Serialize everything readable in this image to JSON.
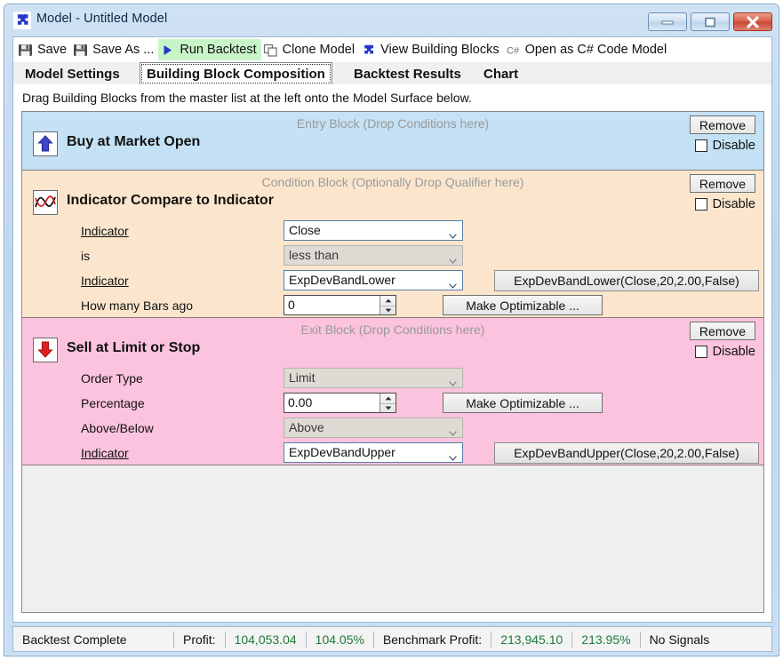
{
  "window": {
    "title": "Model - Untitled Model",
    "icon": "puzzle-piece-icon",
    "caption_buttons": {
      "minimize": "minimize-icon",
      "maximize": "maximize-icon",
      "close": "close-icon"
    }
  },
  "toolbar": {
    "items": [
      {
        "label": "Save",
        "icon": "floppy-disk-icon",
        "active": false
      },
      {
        "label": "Save As ...",
        "icon": "floppy-disk-icon",
        "active": false
      },
      {
        "label": "Run Backtest",
        "icon": "play-triangle-icon",
        "active": true
      },
      {
        "label": "Clone Model",
        "icon": "copy-windows-icon",
        "active": false
      },
      {
        "label": "View Building Blocks",
        "icon": "puzzle-piece-icon",
        "active": false
      },
      {
        "label": "Open as C# Code Model",
        "icon": "csharp-icon",
        "active": false
      }
    ]
  },
  "tabs": [
    {
      "label": "Model Settings",
      "selected": false
    },
    {
      "label": "Building Block Composition",
      "selected": true
    },
    {
      "label": "Backtest Results",
      "selected": false
    },
    {
      "label": "Chart",
      "selected": false
    }
  ],
  "hint": "Drag Building Blocks from the master list at the left onto the Model Surface below.",
  "blocks": [
    {
      "kind": "entry",
      "header": "Entry Block (Drop Conditions here)",
      "title": "Buy at Market Open",
      "icon": "blue-up-arrow-icon",
      "remove_label": "Remove",
      "disable_label": "Disable",
      "disable_checked": false,
      "fields": []
    },
    {
      "kind": "condition",
      "header": "Condition Block (Optionally Drop Qualifier here)",
      "title": "Indicator Compare to Indicator",
      "icon": "indicator-curve-icon",
      "remove_label": "Remove",
      "disable_label": "Disable",
      "disable_checked": false,
      "fields": [
        {
          "label": "Indicator",
          "link": true,
          "control": "combo",
          "value": "Close",
          "enabled": true,
          "side": null
        },
        {
          "label": "is",
          "link": false,
          "control": "combo",
          "value": "less than",
          "enabled": false,
          "side": null
        },
        {
          "label": "Indicator",
          "link": true,
          "control": "combo",
          "value": "ExpDevBandLower",
          "enabled": true,
          "side": "ExpDevBandLower(Close,20,2.00,False)",
          "side_type": "indicator-button"
        },
        {
          "label": "How many Bars ago",
          "link": false,
          "control": "spinner",
          "value": "0",
          "enabled": true,
          "side": "Make Optimizable ...",
          "side_type": "optimize-button"
        }
      ]
    },
    {
      "kind": "exit",
      "header": "Exit Block (Drop Conditions here)",
      "title": "Sell at Limit or Stop",
      "icon": "red-down-arrow-icon",
      "remove_label": "Remove",
      "disable_label": "Disable",
      "disable_checked": false,
      "fields": [
        {
          "label": "Order Type",
          "link": false,
          "control": "combo",
          "value": "Limit",
          "enabled": false,
          "side": null
        },
        {
          "label": "Percentage",
          "link": false,
          "control": "spinner",
          "value": "0.00",
          "enabled": true,
          "side": "Make Optimizable ...",
          "side_type": "optimize-button"
        },
        {
          "label": "Above/Below",
          "link": false,
          "control": "combo",
          "value": "Above",
          "enabled": false,
          "side": null
        },
        {
          "label": "Indicator",
          "link": true,
          "control": "combo",
          "value": "ExpDevBandUpper",
          "enabled": true,
          "side": "ExpDevBandUpper(Close,20,2.00,False)",
          "side_type": "indicator-button"
        }
      ]
    }
  ],
  "statusbar": {
    "status": "Backtest Complete",
    "profit_label": "Profit:",
    "profit_value": "104,053.04",
    "profit_percent": "104.05%",
    "benchmark_label": "Benchmark Profit:",
    "benchmark_value": "213,945.10",
    "benchmark_percent": "213.95%",
    "signals": "No Signals"
  },
  "colors": {
    "entry_block": "#c4e1f5",
    "condition_block": "#fbe6cd",
    "exit_block": "#fbc3dd",
    "run_highlight": "#c8f5c8",
    "profit_green": "#1e7a3c"
  }
}
